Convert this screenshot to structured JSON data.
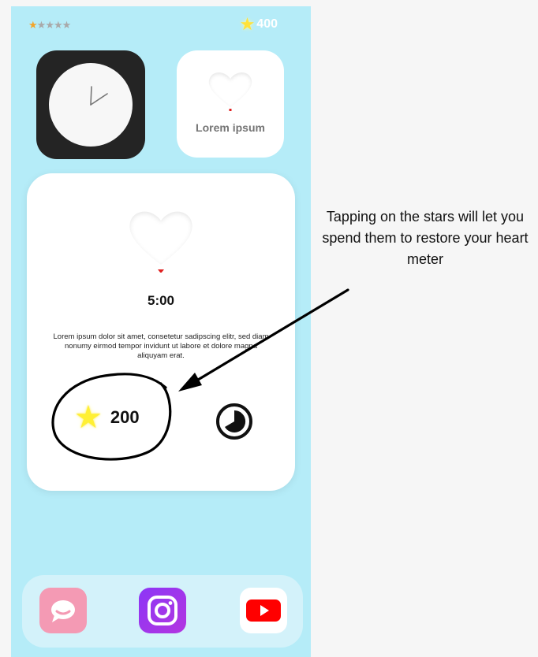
{
  "status_bar": {
    "rating": {
      "filled": 1,
      "total": 5
    },
    "currency_count": "400",
    "star_icon": "star-icon"
  },
  "widgets": {
    "clock": {
      "icon": "clock-icon"
    },
    "heart_small": {
      "label": "Lorem ipsum",
      "icon": "heart-icon"
    }
  },
  "main_card": {
    "timer": "5:00",
    "description": "Lorem ipsum dolor sit amet, consetetur sadipscing elitr, sed diam nonumy eirmod tempor invidunt ut labore et dolore magna aliquyam erat.",
    "currency_count": "200",
    "icons": [
      "heart-icon",
      "star-icon",
      "timer-icon"
    ]
  },
  "dock": {
    "apps": [
      "chat-app-icon",
      "instagram-app-icon",
      "youtube-app-icon"
    ]
  },
  "annotation": {
    "text": "Tapping on the stars will let you spend them to restore your heart meter"
  },
  "colors": {
    "background": "#b5ecf8",
    "card": "#ffffff",
    "star": "#ffe23a",
    "heart_indicator": "#e02020",
    "chat_app": "#f49ab4",
    "instagram_app": "#8c36f6",
    "youtube_app": "#ff0000"
  }
}
